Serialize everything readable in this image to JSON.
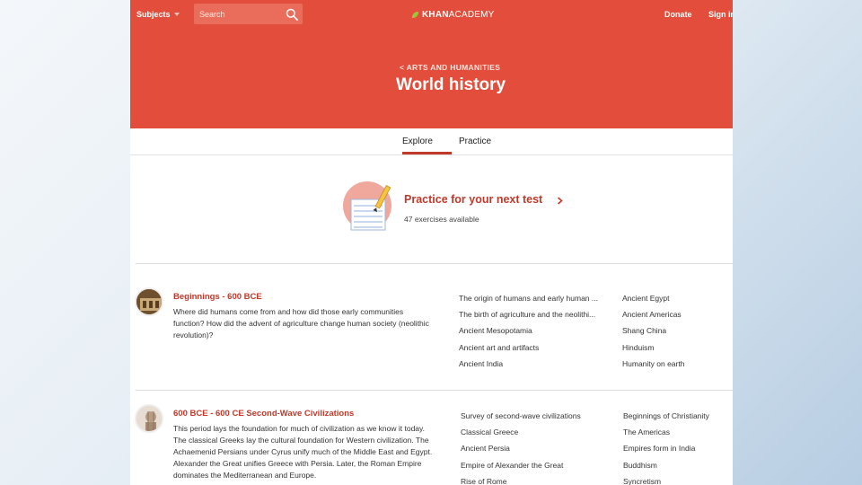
{
  "header": {
    "subjects_label": "Subjects",
    "search_placeholder": "Search",
    "logo_bold": "KHAN",
    "logo_light": "ACADEMY",
    "donate_label": "Donate",
    "signin_label": "Sign in",
    "breadcrumb": "< ARTS AND HUMANITIES",
    "title": "World history"
  },
  "tabs": [
    {
      "label": "Explore"
    },
    {
      "label": "Practice"
    }
  ],
  "practice": {
    "title": "Practice for your next test",
    "count": "47 exercises available"
  },
  "sections": [
    {
      "title": "Beginnings - 600 BCE",
      "description": "Where did humans come from and how did those early communities function? How did the advent of agriculture change human society (neolithic revolution)?",
      "topics_left": [
        "The origin of humans and early human ...",
        "The birth of agriculture and the neolithi...",
        "Ancient Mesopotamia",
        "Ancient art and artifacts",
        "Ancient India"
      ],
      "topics_right": [
        "Ancient Egypt",
        "Ancient Americas",
        "Shang China",
        "Hinduism",
        "Humanity on earth"
      ]
    },
    {
      "title": "600 BCE - 600 CE Second-Wave Civilizations",
      "description": "This period lays the foundation for much of civilization as we know it today. The classical Greeks lay the cultural foundation for Western civilization. The Achaemenid Persians under Cyrus unify much of the Middle East and Egypt. Alexander the Great unifies Greece with Persia. Later, the Roman Empire dominates the Mediterranean and Europe.",
      "topics_left": [
        "Survey of second-wave civilizations",
        "Classical Greece",
        "Ancient Persia",
        "Empire of Alexander the Great",
        "Rise of Rome"
      ],
      "topics_right": [
        "Beginnings of Christianity",
        "The Americas",
        "Empires form in India",
        "Buddhism",
        "Syncretism"
      ]
    }
  ],
  "colors": {
    "brand_red": "#e24e3b",
    "accent_red": "#c0392b",
    "leaf_green": "#9cc43c"
  }
}
